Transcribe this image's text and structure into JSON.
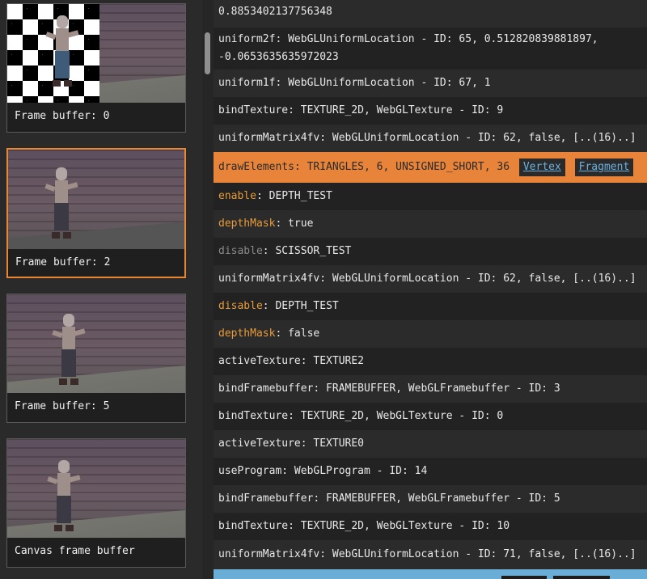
{
  "thumbnails": [
    {
      "caption": "Frame buffer: 0",
      "selected": false
    },
    {
      "caption": "Frame buffer: 2",
      "selected": true
    },
    {
      "caption": "Frame buffer: 5",
      "selected": false
    },
    {
      "caption": "Canvas frame buffer",
      "selected": false
    }
  ],
  "commands": [
    {
      "text": "0.8853402137756348"
    },
    {
      "text": "uniform2f: WebGLUniformLocation - ID: 65, 0.512820839881897,\n-0.0653635635972023"
    },
    {
      "text": "uniform1f: WebGLUniformLocation - ID: 67, 1"
    },
    {
      "text": "bindTexture: TEXTURE_2D, WebGLTexture - ID: 9"
    },
    {
      "text": "uniformMatrix4fv: WebGLUniformLocation - ID: 62, false, [..(16)..]"
    },
    {
      "text": "drawElements: TRIANGLES, 6, UNSIGNED_SHORT, 36",
      "vertex_link": "Vertex",
      "fragment_link": "Fragment"
    },
    {
      "fn": "enable",
      "args": ": DEPTH_TEST"
    },
    {
      "fn": "depthMask",
      "args": ": true"
    },
    {
      "fn": "disable",
      "args": ": SCISSOR_TEST"
    },
    {
      "text": "uniformMatrix4fv: WebGLUniformLocation - ID: 62, false, [..(16)..]"
    },
    {
      "fn": "disable",
      "args": ": DEPTH_TEST"
    },
    {
      "fn": "depthMask",
      "args": ": false"
    },
    {
      "text": "activeTexture: TEXTURE2"
    },
    {
      "text": "bindFramebuffer: FRAMEBUFFER, WebGLFramebuffer - ID: 3"
    },
    {
      "text": "bindTexture: TEXTURE_2D, WebGLTexture - ID: 0"
    },
    {
      "text": "activeTexture: TEXTURE0"
    },
    {
      "text": "useProgram: WebGLProgram - ID: 14"
    },
    {
      "text": "bindFramebuffer: FRAMEBUFFER, WebGLFramebuffer - ID: 5"
    },
    {
      "text": "bindTexture: TEXTURE_2D, WebGLTexture - ID: 10"
    },
    {
      "text": "uniformMatrix4fv: WebGLUniformLocation - ID: 71, false, [..(16)..]"
    }
  ],
  "colors": {
    "highlight": "#e8833a",
    "function_orange": "#e79b3a",
    "function_disabled": "#8a8a8a",
    "link": "#6ab0de",
    "bottom_bar": "#6aaed8"
  }
}
